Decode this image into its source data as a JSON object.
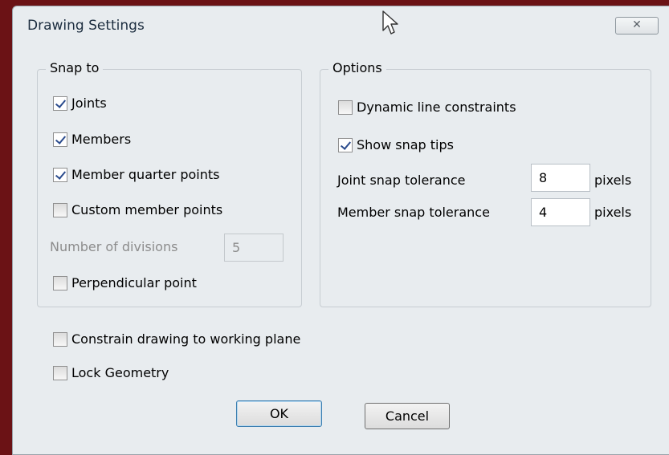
{
  "colors": {
    "background": "#6b1215",
    "dialog": "#e8ecef"
  },
  "dialog": {
    "title": "Drawing Settings",
    "close_icon": "close-icon"
  },
  "snap_to": {
    "title": "Snap to",
    "joints": {
      "label": "Joints",
      "checked": true
    },
    "members": {
      "label": "Members",
      "checked": true
    },
    "member_quarter_points": {
      "label": "Member quarter points",
      "checked": true
    },
    "custom_member_points": {
      "label": "Custom member points",
      "checked": false
    },
    "number_of_divisions": {
      "label": "Number of divisions",
      "value": "5"
    },
    "perpendicular_point": {
      "label": "Perpendicular point",
      "checked": false
    }
  },
  "options": {
    "title": "Options",
    "dynamic_line_constraints": {
      "label": "Dynamic line constraints",
      "checked": false
    },
    "show_snap_tips": {
      "label": "Show snap tips",
      "checked": true
    },
    "joint_snap_tolerance": {
      "label": "Joint snap tolerance",
      "value": "8",
      "unit": "pixels"
    },
    "member_snap_tolerance": {
      "label": "Member snap tolerance",
      "value": "4",
      "unit": "pixels"
    }
  },
  "constrain_to_working_plane": {
    "label": "Constrain drawing to working plane",
    "checked": false
  },
  "lock_geometry": {
    "label": "Lock Geometry",
    "checked": false
  },
  "buttons": {
    "ok": "OK",
    "cancel": "Cancel"
  }
}
